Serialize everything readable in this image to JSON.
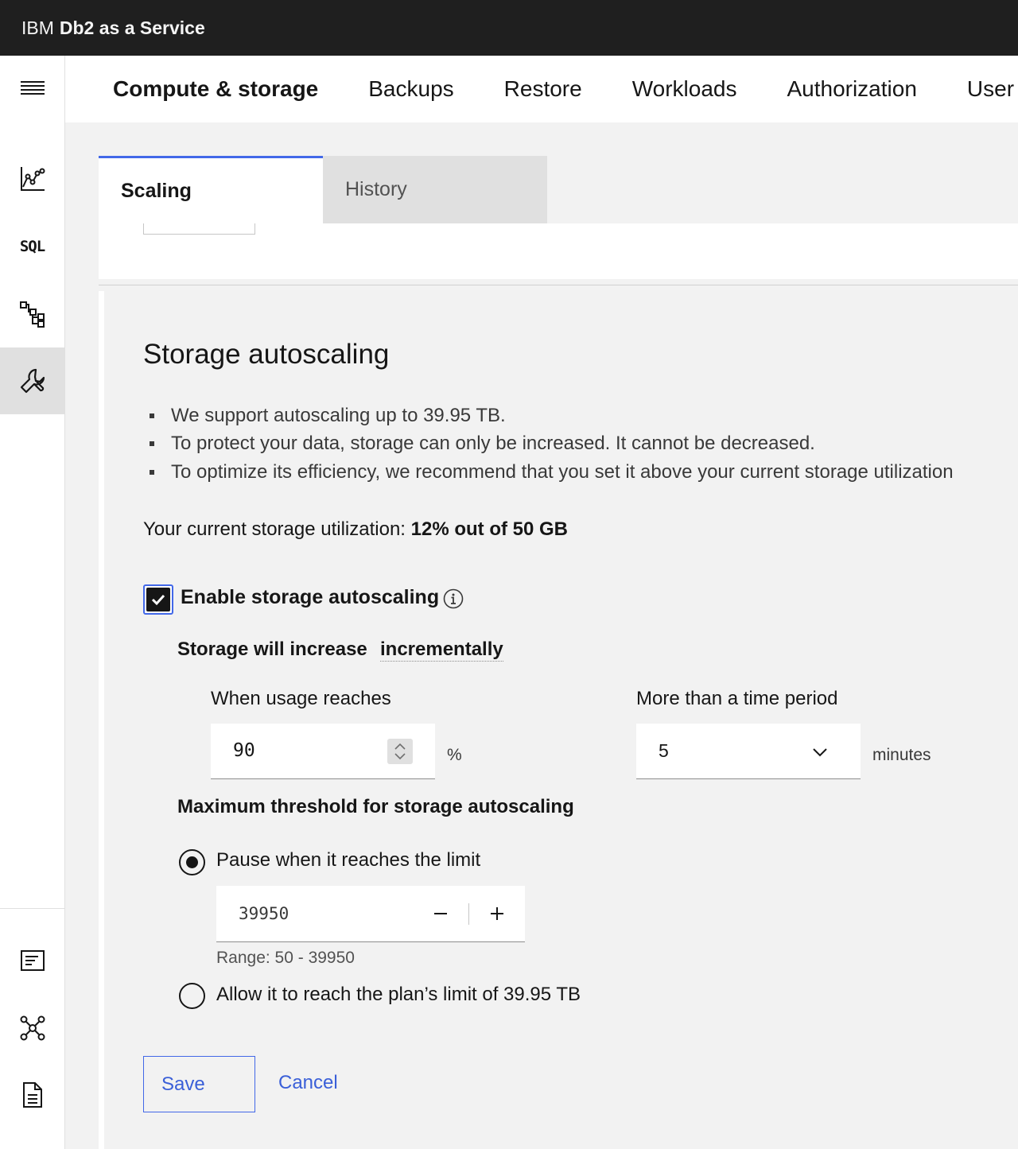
{
  "topbar": {
    "brand_prefix": "IBM",
    "brand_name": "Db2 as a Service"
  },
  "rail": {
    "items": [
      {
        "icon": "menu-icon"
      },
      {
        "icon": "chart-icon"
      },
      {
        "icon": "sql-icon",
        "text": "SQL"
      },
      {
        "icon": "hierarchy-icon"
      },
      {
        "icon": "wrench-icon",
        "active": true
      },
      {
        "icon": "document-list-icon"
      },
      {
        "icon": "network-icon"
      },
      {
        "icon": "file-icon"
      }
    ]
  },
  "nav": {
    "items": [
      {
        "label": "Compute & storage",
        "active": true
      },
      {
        "label": "Backups"
      },
      {
        "label": "Restore"
      },
      {
        "label": "Workloads"
      },
      {
        "label": "Authorization"
      },
      {
        "label": "User"
      }
    ]
  },
  "subtabs": [
    {
      "label": "Scaling",
      "active": true
    },
    {
      "label": "History"
    }
  ],
  "storage": {
    "title": "Storage autoscaling",
    "bullets": [
      "We support autoscaling up to 39.95 TB.",
      "To protect your data, storage can only be increased. It cannot be decreased.",
      "To optimize its efficiency, we recommend that you set it above your current storage utilization"
    ],
    "utilization_prefix": "Your current storage utilization:",
    "utilization_value": "12% out of 50 GB",
    "enable_label": "Enable storage autoscaling",
    "enable_checked": true,
    "increase_label": "Storage will increase",
    "increase_mode": "incrementally",
    "usage_label": "When usage reaches",
    "usage_value": "90",
    "usage_unit": "%",
    "period_label": "More than a time period",
    "period_value": "5",
    "period_unit": "minutes",
    "max_label": "Maximum threshold for storage autoscaling",
    "option_pause": "Pause when it reaches the limit",
    "limit_value": "39950",
    "range_text": "Range: 50 - 39950",
    "option_allow": "Allow it to reach the plan’s limit of 39.95 TB",
    "selected_option": "pause"
  },
  "actions": {
    "save": "Save",
    "cancel": "Cancel"
  },
  "colors": {
    "accent": "#4268e8",
    "topbar": "#1f1f1f",
    "link": "#3a5fd8"
  }
}
